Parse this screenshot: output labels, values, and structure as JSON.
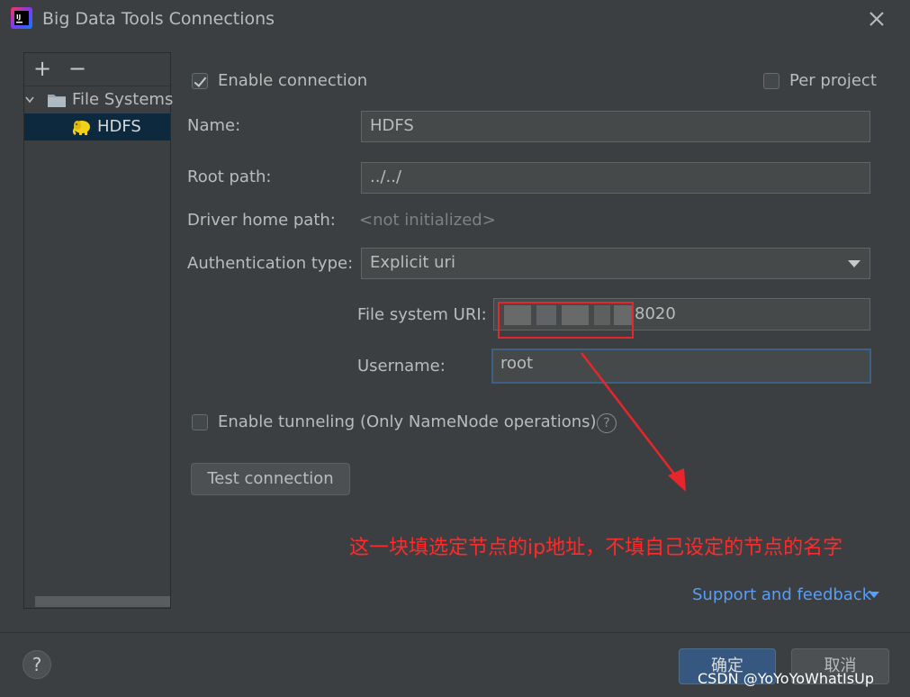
{
  "window": {
    "title": "Big Data Tools Connections",
    "app_icon": "intellij-icon",
    "close_icon": "close-icon"
  },
  "sidebar": {
    "toolbar": {
      "add_label": "+",
      "remove_label": "−"
    },
    "tree": [
      {
        "label": "File Systems",
        "icon": "folder-icon",
        "expanded": true,
        "selected": false
      },
      {
        "label": "HDFS",
        "icon": "hadoop-elephant-icon",
        "selected": true
      }
    ]
  },
  "form": {
    "enable_connection": {
      "label": "Enable connection",
      "checked": true
    },
    "per_project": {
      "label": "Per project",
      "checked": false
    },
    "name": {
      "label": "Name:",
      "value": "HDFS"
    },
    "root_path": {
      "label": "Root path:",
      "value": "../../"
    },
    "driver_home_path": {
      "label": "Driver home path:",
      "value": "<not initialized>"
    },
    "auth_type": {
      "label": "Authentication type:",
      "selected": "Explicit uri"
    },
    "fs_uri": {
      "label": "File system URI:",
      "value_visible": "8020"
    },
    "username": {
      "label": "Username:",
      "value": "root"
    },
    "enable_tunneling": {
      "label": "Enable tunneling (Only NameNode operations)",
      "checked": false,
      "help_glyph": "?"
    },
    "test_connection": {
      "label": "Test connection"
    }
  },
  "annotation": {
    "text": "这一块填选定节点的ip地址，不填自己设定的节点的名字",
    "color": "#ff2a2a"
  },
  "support_link": {
    "label": "Support and feedback"
  },
  "footer": {
    "help_glyph": "?",
    "ok_label": "确定",
    "cancel_label": "取消",
    "watermark": "CSDN @YoYoYoWhatIsUp"
  },
  "colors": {
    "background": "#3c3f41",
    "selection": "#0d293e",
    "primary_button": "#365880",
    "link": "#589df6",
    "annotation": "#ff2a2a"
  }
}
